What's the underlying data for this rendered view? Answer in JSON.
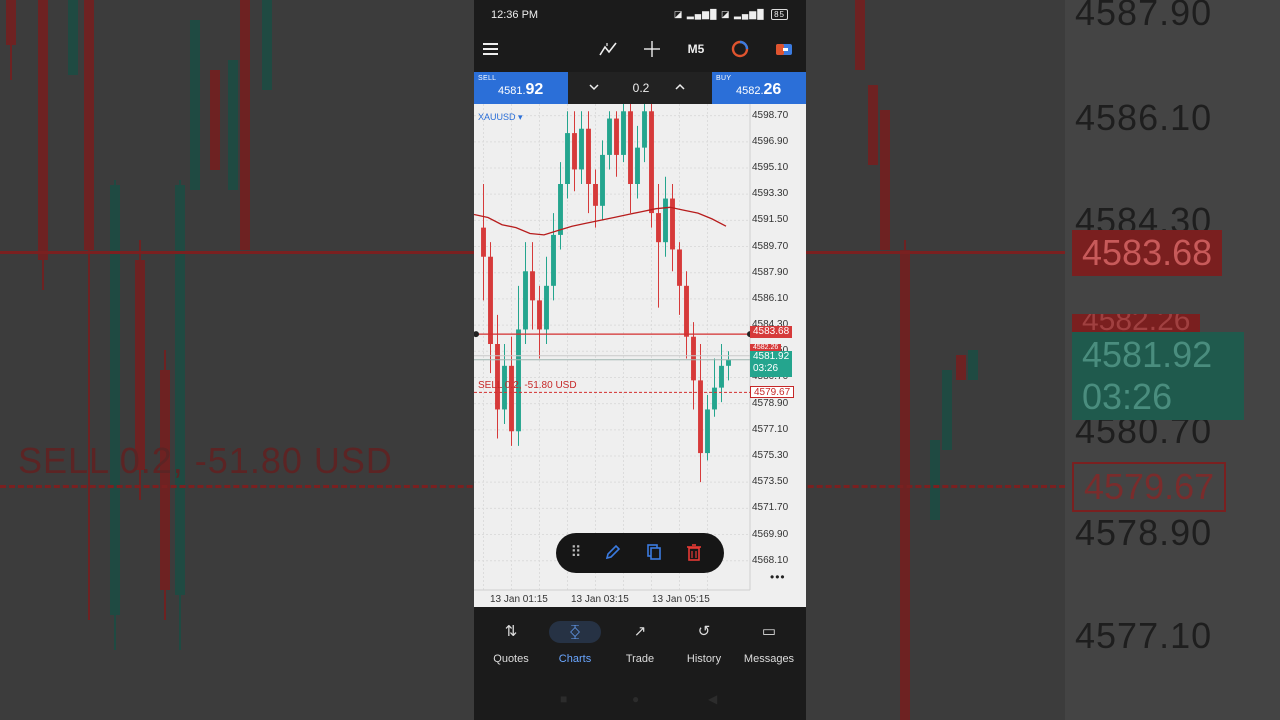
{
  "status_bar": {
    "time": "12:36 PM",
    "signal": "◪ ▂▄▆█ ◪ ▂▄▆█",
    "battery": "85"
  },
  "toolbar": {
    "timeframe": "M5"
  },
  "trade": {
    "sell_label": "SELL",
    "sell_price_main": "4581.",
    "sell_price_big": "92",
    "buy_label": "BUY",
    "buy_price_main": "4582.",
    "buy_price_big": "26",
    "lot": "0.2"
  },
  "chart": {
    "symbol": "XAUUSD ▾",
    "price_tag_current": "4583.68",
    "price_tag_bid": "4581.92",
    "price_tag_timer": "03:26",
    "price_tag_order": "4579.67",
    "price_tag_partial": "4582.26",
    "order_label": "SELL 0.2, -51.80 USD",
    "more": "•••"
  },
  "chart_data": {
    "type": "candlestick",
    "symbol": "XAUUSD",
    "timeframe": "M5",
    "y_ticks": [
      "4598.70",
      "4596.90",
      "4595.10",
      "4593.30",
      "4591.50",
      "4589.70",
      "4587.90",
      "4586.10",
      "4584.30",
      "4582.50",
      "4580.70",
      "4578.90",
      "4577.10",
      "4575.30",
      "4573.50",
      "4571.70",
      "4569.90",
      "4568.10"
    ],
    "x_ticks": [
      "13 Jan 01:15",
      "13 Jan 03:15",
      "13 Jan 05:15"
    ],
    "ylim": [
      4566.5,
      4599.5
    ],
    "lines": {
      "current_price": 4583.68,
      "bid": 4581.92,
      "order_price": 4579.67
    },
    "moving_average": [
      4591.9,
      4591.7,
      4591.2,
      4591.0,
      4590.6,
      4590.5,
      4590.8,
      4591.1,
      4591.3,
      4591.5,
      4591.7,
      4591.9,
      4592.1,
      4592.3,
      4592.4,
      4592.2,
      4592.0,
      4591.6,
      4591.1
    ],
    "candles": [
      {
        "o": 4591.0,
        "c": 4589.0,
        "h": 4594.0,
        "l": 4586.0
      },
      {
        "o": 4589.0,
        "c": 4583.0,
        "h": 4590.0,
        "l": 4581.0
      },
      {
        "o": 4583.0,
        "c": 4578.5,
        "h": 4585.0,
        "l": 4576.5
      },
      {
        "o": 4578.5,
        "c": 4581.5,
        "h": 4583.0,
        "l": 4577.5
      },
      {
        "o": 4581.5,
        "c": 4577.0,
        "h": 4583.5,
        "l": 4576.0
      },
      {
        "o": 4577.0,
        "c": 4584.0,
        "h": 4587.0,
        "l": 4576.0
      },
      {
        "o": 4584.0,
        "c": 4588.0,
        "h": 4590.0,
        "l": 4583.0
      },
      {
        "o": 4588.0,
        "c": 4586.0,
        "h": 4590.0,
        "l": 4584.0
      },
      {
        "o": 4586.0,
        "c": 4584.0,
        "h": 4587.0,
        "l": 4582.0
      },
      {
        "o": 4584.0,
        "c": 4587.0,
        "h": 4589.0,
        "l": 4583.0
      },
      {
        "o": 4587.0,
        "c": 4590.5,
        "h": 4592.0,
        "l": 4586.0
      },
      {
        "o": 4590.5,
        "c": 4594.0,
        "h": 4595.5,
        "l": 4589.5
      },
      {
        "o": 4594.0,
        "c": 4597.5,
        "h": 4599.0,
        "l": 4593.0
      },
      {
        "o": 4597.5,
        "c": 4595.0,
        "h": 4599.0,
        "l": 4593.5
      },
      {
        "o": 4595.0,
        "c": 4597.8,
        "h": 4599.0,
        "l": 4594.0
      },
      {
        "o": 4597.8,
        "c": 4594.0,
        "h": 4599.0,
        "l": 4592.0
      },
      {
        "o": 4594.0,
        "c": 4592.5,
        "h": 4595.0,
        "l": 4591.0
      },
      {
        "o": 4592.5,
        "c": 4596.0,
        "h": 4597.0,
        "l": 4591.5
      },
      {
        "o": 4596.0,
        "c": 4598.5,
        "h": 4599.0,
        "l": 4595.0
      },
      {
        "o": 4598.5,
        "c": 4596.0,
        "h": 4599.0,
        "l": 4594.5
      },
      {
        "o": 4596.0,
        "c": 4599.0,
        "h": 4599.5,
        "l": 4595.5
      },
      {
        "o": 4599.0,
        "c": 4594.0,
        "h": 4599.5,
        "l": 4592.0
      },
      {
        "o": 4594.0,
        "c": 4596.5,
        "h": 4598.0,
        "l": 4593.0
      },
      {
        "o": 4596.5,
        "c": 4599.0,
        "h": 4599.5,
        "l": 4595.5
      },
      {
        "o": 4599.0,
        "c": 4592.0,
        "h": 4599.5,
        "l": 4591.0
      },
      {
        "o": 4592.0,
        "c": 4590.0,
        "h": 4594.0,
        "l": 4585.5
      },
      {
        "o": 4590.0,
        "c": 4593.0,
        "h": 4594.5,
        "l": 4589.0
      },
      {
        "o": 4593.0,
        "c": 4589.5,
        "h": 4594.0,
        "l": 4588.0
      },
      {
        "o": 4589.5,
        "c": 4587.0,
        "h": 4590.0,
        "l": 4585.0
      },
      {
        "o": 4587.0,
        "c": 4583.5,
        "h": 4588.0,
        "l": 4582.0
      },
      {
        "o": 4583.5,
        "c": 4580.5,
        "h": 4584.5,
        "l": 4578.5
      },
      {
        "o": 4580.5,
        "c": 4575.5,
        "h": 4583.0,
        "l": 4573.5
      },
      {
        "o": 4575.5,
        "c": 4578.5,
        "h": 4579.5,
        "l": 4575.0
      },
      {
        "o": 4578.5,
        "c": 4580.0,
        "h": 4582.0,
        "l": 4578.0
      },
      {
        "o": 4580.0,
        "c": 4581.5,
        "h": 4583.0,
        "l": 4579.0
      },
      {
        "o": 4581.5,
        "c": 4581.9,
        "h": 4582.5,
        "l": 4580.5
      }
    ]
  },
  "float_bar": {
    "drag": "⠿",
    "edit": "✎",
    "copy": "❐",
    "delete": "🗑"
  },
  "nav": [
    {
      "label": "Quotes",
      "icon": "⇅"
    },
    {
      "label": "Charts",
      "icon": "⧰"
    },
    {
      "label": "Trade",
      "icon": "↗"
    },
    {
      "label": "History",
      "icon": "↺"
    },
    {
      "label": "Messages",
      "icon": "▭"
    }
  ],
  "background": {
    "prices": [
      "4587.90",
      "4586.10",
      "4584.30",
      "4580.70",
      "4578.90",
      "4577.10"
    ],
    "current": "4583.68",
    "bid": "4581.92",
    "timer": "03:26",
    "order": "4579.67",
    "partial": "4582.26",
    "order_label": "SELL 0.2,  -51.80 USD"
  },
  "colors": {
    "buy_sell": "#2b6fd8",
    "bull": "#24a58e",
    "bear": "#d63a3a",
    "accent": "#6aa6ff"
  }
}
